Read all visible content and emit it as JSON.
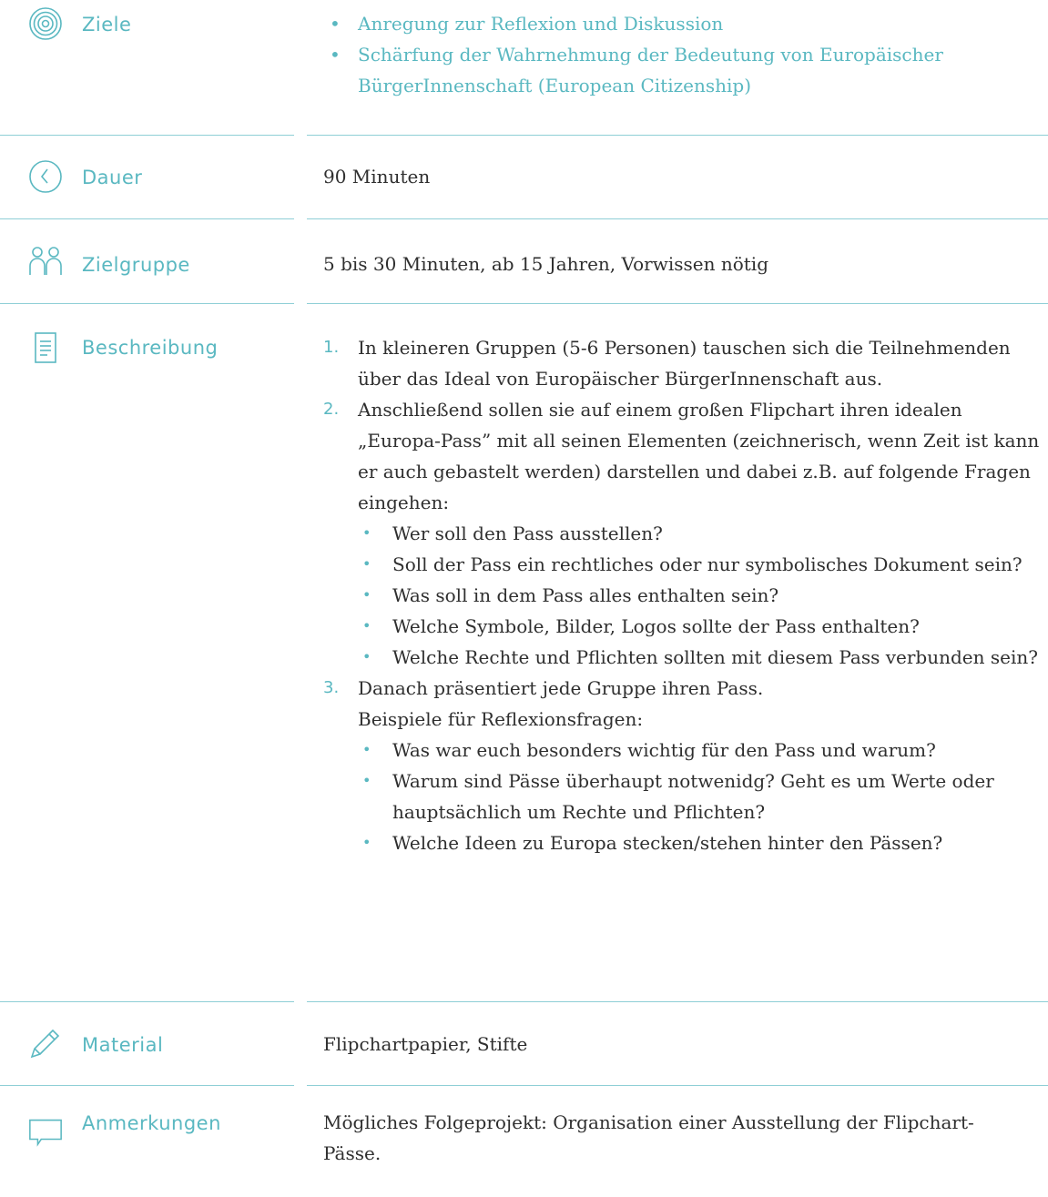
{
  "sections": {
    "ziele": {
      "label": "Ziele",
      "items": [
        "Anregung zur Reflexion und Diskussion",
        "Schärfung der Wahrnehmung der Bedeutung von Europäischer BürgerInnenschaft (European Citizenship)"
      ]
    },
    "dauer": {
      "label": "Dauer",
      "text": "90 Minuten"
    },
    "zielgruppe": {
      "label": "Zielgruppe",
      "text": "5 bis 30 Minuten, ab 15 Jahren, Vorwissen nötig"
    },
    "beschreibung": {
      "label": "Beschreibung",
      "steps": [
        {
          "num": "1.",
          "text": "In kleineren Gruppen (5-6 Personen) tauschen sich die Teilneh­menden über das Ideal von Europäischer BürgerInnenschaft aus.",
          "sub": []
        },
        {
          "num": "2.",
          "text": "Anschließend sollen sie auf einem großen Flipchart ihren idealen „Europa-Pass” mit all seinen Elementen (zeichnerisch, wenn Zeit ist kann er auch gebastelt werden) darstellen und dabei z.B. auf folgende Fragen eingehen:",
          "sub": [
            "Wer soll den Pass ausstellen?",
            "Soll der Pass ein rechtliches oder nur symbolisches Dokument sein?",
            "Was soll in dem Pass alles enthalten sein?",
            "Welche Symbole, Bilder, Logos sollte der Pass enthalten?",
            "Welche Rechte und Pflichten sollten mit diesem Pass verbunden sein?"
          ]
        },
        {
          "num": "3.",
          "text": "Danach präsentiert jede Gruppe ihren Pass.",
          "text2": "Beispiele für Reflexionsfragen:",
          "sub": [
            "Was war euch besonders wichtig für den Pass und warum?",
            "Warum sind Pässe überhaupt notwenidg? Geht es um Werte oder hauptsächlich um Rechte und Pflichten?",
            "Welche Ideen zu Europa stecken/stehen hinter den Pässen?"
          ]
        }
      ]
    },
    "material": {
      "label": "Material",
      "text": "Flipchartpapier, Stifte"
    },
    "anmerkungen": {
      "label": "Anmerkungen",
      "text": "Mögliches Folgeprojekt: Organisation einer Ausstellung der Flipchart-Pässe."
    }
  },
  "colors": {
    "accent": "#5ab8c1",
    "text": "#2f2f2f",
    "rule": "#8fcfd6"
  },
  "icons": [
    "target-icon",
    "clock-icon",
    "people-icon",
    "document-icon",
    "pencil-icon",
    "speech-bubble-icon"
  ]
}
